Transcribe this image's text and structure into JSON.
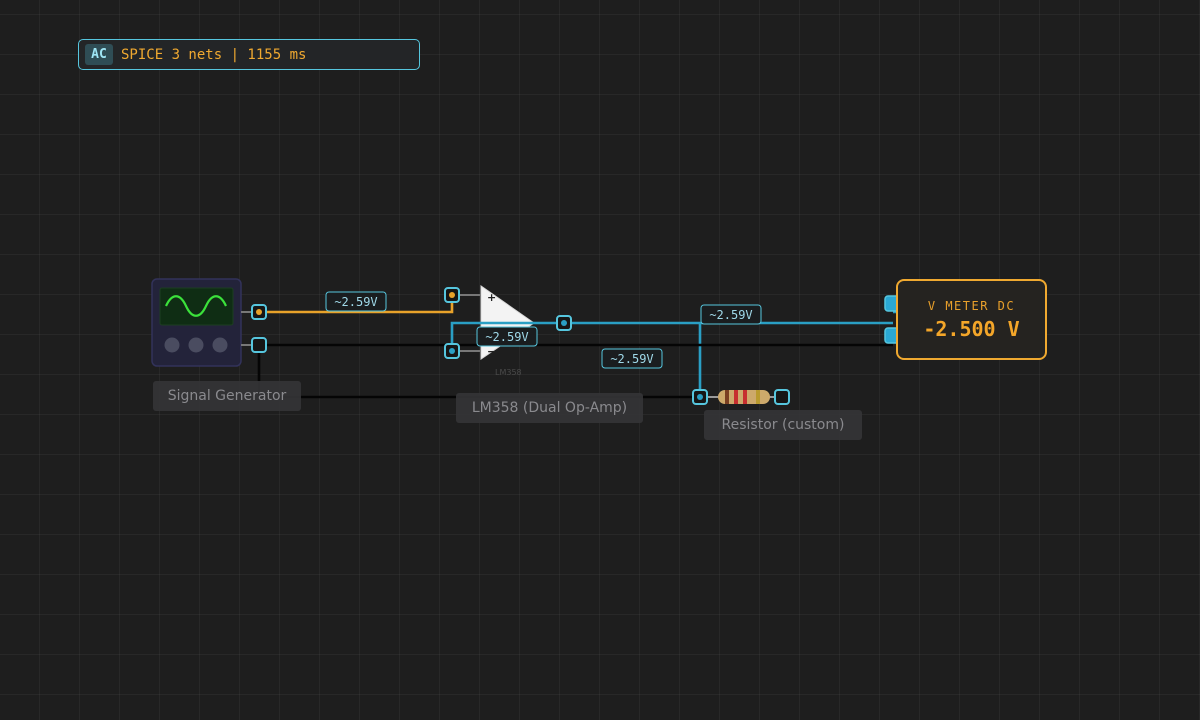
{
  "status_bar": {
    "mode": "AC",
    "text": "SPICE 3 nets | 1155 ms"
  },
  "components": {
    "signal_generator": {
      "label": "Signal Generator"
    },
    "op_amp": {
      "label": "LM358 (Dual Op-Amp)",
      "part_marking": "LM358",
      "plus_symbol": "+",
      "minus_symbol": "−"
    },
    "resistor": {
      "label": "Resistor (custom)"
    },
    "voltmeter": {
      "title": "V METER DC",
      "value": "-2.500 V"
    }
  },
  "net_voltage_labels": [
    "~2.59V",
    "~2.59V",
    "~2.59V",
    "~2.59V"
  ],
  "colors": {
    "accent": "#56c6de",
    "warning": "#f0a930",
    "wire_signal": "#e8a22a",
    "wire_output": "#2a9fc4",
    "wire_ground": "#050505",
    "waveform": "#3be13b"
  }
}
